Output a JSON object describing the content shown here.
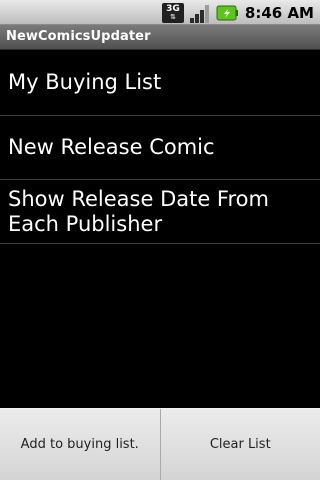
{
  "status_bar": {
    "network_type": "3G",
    "time": "8:46",
    "ampm": "AM",
    "icons": [
      "network-3g-icon",
      "signal-strength-icon",
      "battery-icon"
    ]
  },
  "app": {
    "title": "NewComicsUpdater"
  },
  "list": {
    "items": [
      {
        "label": "My Buying List"
      },
      {
        "label": "New Release Comic"
      },
      {
        "label": "Show Release Date From Each Publisher"
      }
    ]
  },
  "menu": {
    "items": [
      {
        "label": "Add to buying list."
      },
      {
        "label": "Clear List"
      }
    ]
  },
  "colors": {
    "background": "#000000",
    "status_bar": "#d4d4d4",
    "title_bar": "#5f5f5f",
    "battery_green": "#5cc51d",
    "menu_bg": "#dcdcdc"
  }
}
